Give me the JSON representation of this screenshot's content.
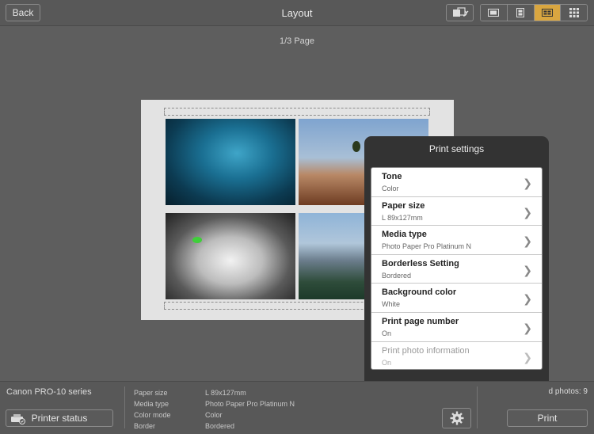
{
  "header": {
    "back_label": "Back",
    "title": "Layout",
    "layout_modes": [
      "single-layout-icon",
      "vertical-layout-icon",
      "grid-4-layout-icon",
      "grid-9-layout-icon"
    ],
    "active_mode": 2
  },
  "page_indicator": "1/3 Page",
  "print_settings": {
    "title": "Print settings",
    "items": [
      {
        "label": "Tone",
        "value": "Color",
        "enabled": true
      },
      {
        "label": "Paper size",
        "value": "L 89x127mm",
        "enabled": true
      },
      {
        "label": "Media type",
        "value": "Photo Paper Pro Platinum N",
        "enabled": true
      },
      {
        "label": "Borderless Setting",
        "value": "Bordered",
        "enabled": true
      },
      {
        "label": "Background color",
        "value": "White",
        "enabled": true
      },
      {
        "label": "Print page number",
        "value": "On",
        "enabled": true
      },
      {
        "label": "Print photo information",
        "value": "On",
        "enabled": false
      }
    ]
  },
  "footer": {
    "printer_name": "Canon PRO-10 series",
    "printer_status_label": "Printer status",
    "info": [
      {
        "label": "Paper size",
        "value": "L 89x127mm"
      },
      {
        "label": "Media type",
        "value": "Photo Paper Pro Platinum N"
      },
      {
        "label": "Color mode",
        "value": "Color"
      },
      {
        "label": "Border",
        "value": "Bordered"
      }
    ],
    "photos_count": "d photos: 9",
    "print_label": "Print"
  },
  "colors": {
    "accent": "#d9a640",
    "background": "#5e5e5e",
    "popover": "#333333"
  }
}
